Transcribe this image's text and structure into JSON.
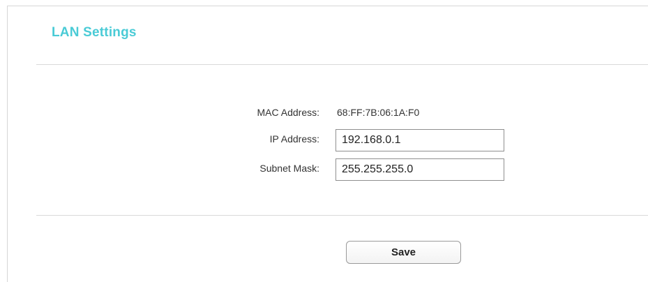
{
  "page": {
    "title": "LAN Settings",
    "accent_color": "#4acbd6"
  },
  "form": {
    "mac_label": "MAC Address:",
    "mac_value": "68:FF:7B:06:1A:F0",
    "ip_label": "IP Address:",
    "ip_value": "192.168.0.1",
    "mask_label": "Subnet Mask:",
    "mask_value": "255.255.255.0"
  },
  "actions": {
    "save_label": "Save"
  }
}
